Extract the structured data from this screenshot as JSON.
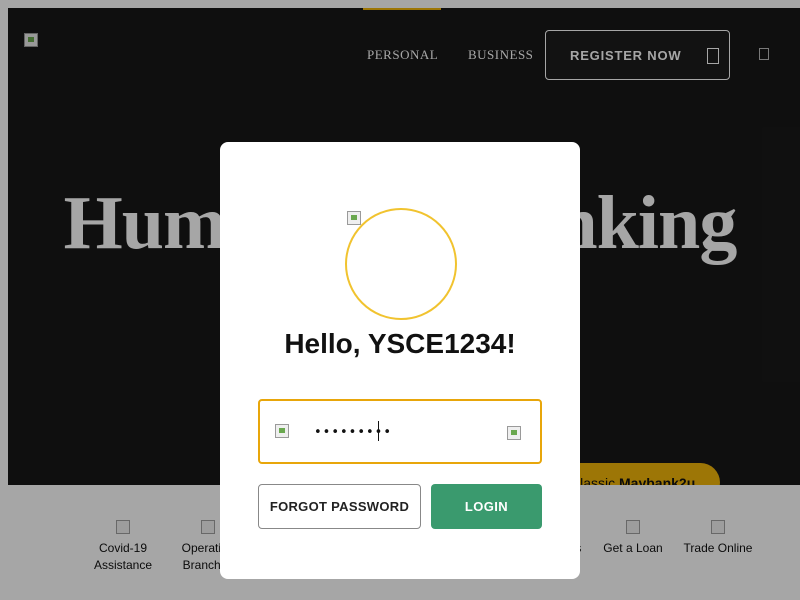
{
  "nav": {
    "personal": "PERSONAL",
    "business": "BUSINESS",
    "register": "REGISTER NOW",
    "active_tab": "PERSONAL"
  },
  "hero": {
    "title": "Humanising Banking"
  },
  "classic": {
    "prefix": "Classic ",
    "brand": "Maybank2u"
  },
  "quick_links": [
    {
      "label": "Covid-19 Assistance"
    },
    {
      "label": "Operating Branches"
    },
    {
      "label": "ds"
    },
    {
      "label": "Get a Loan"
    },
    {
      "label": "Trade Online"
    }
  ],
  "login_modal": {
    "greeting": "Hello, YSCE1234!",
    "password_value": "•••••••••",
    "forgot_label": "FORGOT PASSWORD",
    "login_label": "LOGIN"
  },
  "colors": {
    "accent": "#f1b50a",
    "login_button": "#3a9a6e",
    "hero_bg": "#181818",
    "input_border": "#e8a60a"
  }
}
